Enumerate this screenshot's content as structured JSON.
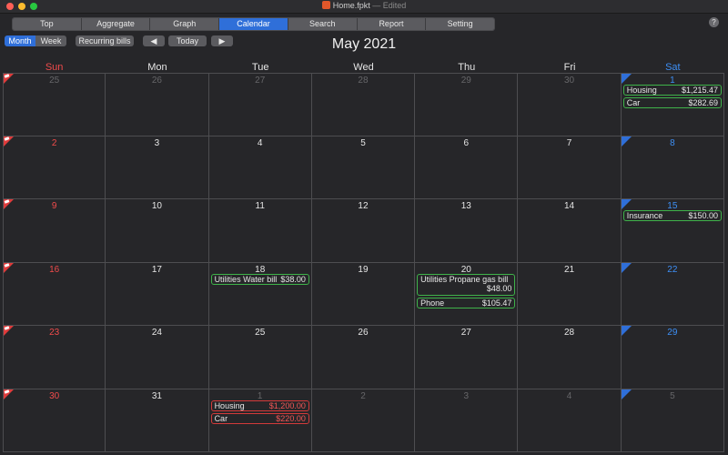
{
  "window": {
    "title": "Home.fpkt",
    "edited": "— Edited"
  },
  "tabs": [
    {
      "label": "Top",
      "active": false
    },
    {
      "label": "Aggregate",
      "active": false
    },
    {
      "label": "Graph",
      "active": false
    },
    {
      "label": "Calendar",
      "active": true
    },
    {
      "label": "Search",
      "active": false
    },
    {
      "label": "Report",
      "active": false
    },
    {
      "label": "Setting",
      "active": false
    }
  ],
  "help": "?",
  "controls": {
    "month_label": "Month",
    "week_label": "Week",
    "recurring_label": "Recurring bills",
    "prev_glyph": "◀",
    "today_label": "Today",
    "next_glyph": "▶"
  },
  "month_title": "May 2021",
  "weekdays": [
    "Sun",
    "Mon",
    "Tue",
    "Wed",
    "Thu",
    "Fri",
    "Sat"
  ],
  "weeks": [
    [
      {
        "day": "25",
        "other": true,
        "events": []
      },
      {
        "day": "26",
        "other": true,
        "events": []
      },
      {
        "day": "27",
        "other": true,
        "events": []
      },
      {
        "day": "28",
        "other": true,
        "events": []
      },
      {
        "day": "29",
        "other": true,
        "events": []
      },
      {
        "day": "30",
        "other": true,
        "events": []
      },
      {
        "day": "1",
        "other": false,
        "events": [
          {
            "name": "Housing",
            "amount": "$1,215.47",
            "color": "green"
          },
          {
            "name": "Car",
            "amount": "$282.69",
            "color": "green"
          }
        ]
      }
    ],
    [
      {
        "day": "2",
        "other": false,
        "events": []
      },
      {
        "day": "3",
        "other": false,
        "events": []
      },
      {
        "day": "4",
        "other": false,
        "events": []
      },
      {
        "day": "5",
        "other": false,
        "events": []
      },
      {
        "day": "6",
        "other": false,
        "events": []
      },
      {
        "day": "7",
        "other": false,
        "events": []
      },
      {
        "day": "8",
        "other": false,
        "events": []
      }
    ],
    [
      {
        "day": "9",
        "other": false,
        "events": []
      },
      {
        "day": "10",
        "other": false,
        "events": []
      },
      {
        "day": "11",
        "other": false,
        "events": []
      },
      {
        "day": "12",
        "other": false,
        "events": []
      },
      {
        "day": "13",
        "other": false,
        "events": []
      },
      {
        "day": "14",
        "other": false,
        "events": []
      },
      {
        "day": "15",
        "other": false,
        "events": [
          {
            "name": "Insurance",
            "amount": "$150.00",
            "color": "green"
          }
        ]
      }
    ],
    [
      {
        "day": "16",
        "other": false,
        "events": []
      },
      {
        "day": "17",
        "other": false,
        "events": []
      },
      {
        "day": "18",
        "other": false,
        "events": [
          {
            "name": "Utilities Water bill",
            "amount": "$38.00",
            "color": "green"
          }
        ]
      },
      {
        "day": "19",
        "other": false,
        "events": []
      },
      {
        "day": "20",
        "other": false,
        "events": [
          {
            "name": "Utilities Propane gas bill",
            "amount": "$48.00",
            "color": "green",
            "tall": true
          },
          {
            "name": "Phone",
            "amount": "$105.47",
            "color": "green"
          }
        ]
      },
      {
        "day": "21",
        "other": false,
        "events": []
      },
      {
        "day": "22",
        "other": false,
        "events": []
      }
    ],
    [
      {
        "day": "23",
        "other": false,
        "events": []
      },
      {
        "day": "24",
        "other": false,
        "events": []
      },
      {
        "day": "25",
        "other": false,
        "events": []
      },
      {
        "day": "26",
        "other": false,
        "events": []
      },
      {
        "day": "27",
        "other": false,
        "events": []
      },
      {
        "day": "28",
        "other": false,
        "events": []
      },
      {
        "day": "29",
        "other": false,
        "events": []
      }
    ],
    [
      {
        "day": "30",
        "other": false,
        "events": []
      },
      {
        "day": "31",
        "other": false,
        "events": []
      },
      {
        "day": "1",
        "other": true,
        "events": [
          {
            "name": "Housing",
            "amount": "$1,200.00",
            "color": "red"
          },
          {
            "name": "Car",
            "amount": "$220.00",
            "color": "red"
          }
        ]
      },
      {
        "day": "2",
        "other": true,
        "events": []
      },
      {
        "day": "3",
        "other": true,
        "events": []
      },
      {
        "day": "4",
        "other": true,
        "events": []
      },
      {
        "day": "5",
        "other": true,
        "events": []
      }
    ]
  ],
  "colors": {
    "green": "#3fb34a",
    "red": "#d43a3a",
    "sunday": "#f04b4b",
    "saturday": "#3d8ff5",
    "accent": "#2f6fd9"
  }
}
